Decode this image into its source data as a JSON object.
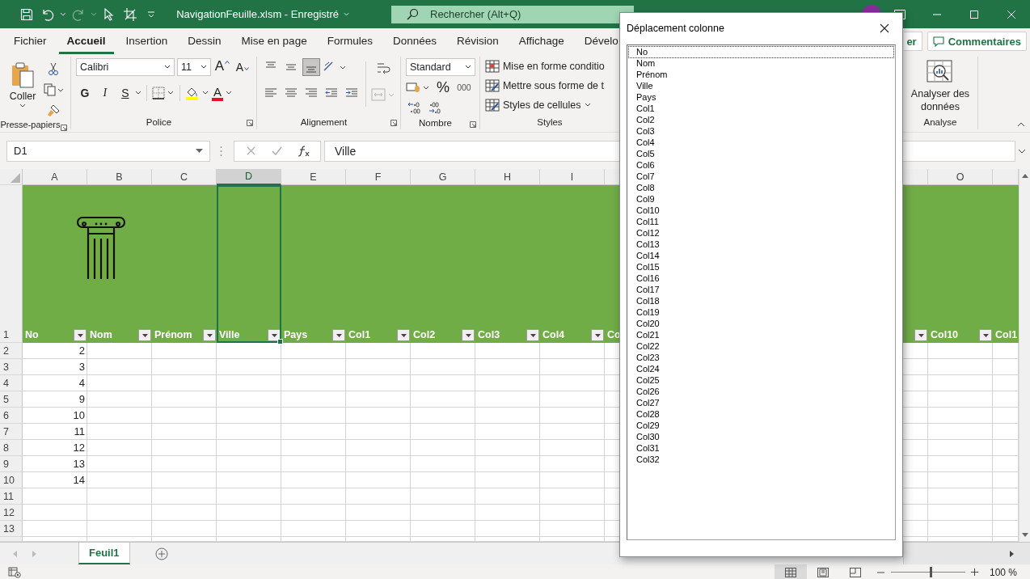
{
  "title_bar": {
    "title": "NavigationFeuille.xlsm  -  Enregistré",
    "search": {
      "placeholder": "Rechercher (Alt+Q)"
    },
    "redo_disabled": true
  },
  "ribbon_tabs": [
    {
      "label": "Fichier",
      "selected": false
    },
    {
      "label": "Accueil",
      "selected": true
    },
    {
      "label": "Insertion",
      "selected": false
    },
    {
      "label": "Dessin",
      "selected": false
    },
    {
      "label": "Mise en page",
      "selected": false
    },
    {
      "label": "Formules",
      "selected": false
    },
    {
      "label": "Données",
      "selected": false
    },
    {
      "label": "Révision",
      "selected": false
    },
    {
      "label": "Affichage",
      "selected": false
    },
    {
      "label": "Dévelo",
      "selected": false
    }
  ],
  "share_button": "er",
  "comments_button": "Commentaires",
  "ribbon": {
    "clipboard": {
      "paste": "Coller",
      "group": "Presse-papiers"
    },
    "font": {
      "family": "Calibri",
      "size": "11",
      "grow": "A",
      "shrink": "A",
      "bold": "G",
      "italic": "I",
      "underline": "S",
      "color_letter": "A",
      "group": "Police"
    },
    "alignment": {
      "vertical_buttons": [
        {
          "selected": false
        },
        {
          "selected": false
        },
        {
          "selected": true
        }
      ],
      "merge_disabled": true,
      "group": "Alignement"
    },
    "number": {
      "format": "Standard",
      "percent": "%",
      "thousands": "000",
      "group": "Nombre"
    },
    "styles": {
      "items": [
        "Mise en forme conditio",
        "Mettre sous forme de t",
        "Styles de cellules"
      ],
      "group": "Styles"
    },
    "analysis": {
      "button": "Analyser des données",
      "group": "Analyse"
    }
  },
  "formula_bar": {
    "name_box": "D1",
    "formula": "Ville"
  },
  "sheet": {
    "columns_left": [
      {
        "letter": "A",
        "header": "No",
        "filter": true,
        "selected": false
      },
      {
        "letter": "B",
        "header": "Nom",
        "filter": true,
        "selected": false
      },
      {
        "letter": "C",
        "header": "Prénom",
        "filter": true,
        "selected": false
      },
      {
        "letter": "D",
        "header": "Ville",
        "filter": true,
        "selected": true
      },
      {
        "letter": "E",
        "header": "Pays",
        "filter": true,
        "selected": false
      },
      {
        "letter": "F",
        "header": "Col1",
        "filter": true,
        "selected": false
      },
      {
        "letter": "G",
        "header": "Col2",
        "filter": true,
        "selected": false
      },
      {
        "letter": "H",
        "header": "Col3",
        "filter": true,
        "selected": false
      },
      {
        "letter": "I",
        "header": "Col4",
        "filter": true,
        "selected": false
      },
      {
        "header": "Co",
        "filter": false,
        "selected": false
      }
    ],
    "columns_right": [
      {
        "filter": true,
        "selected": false
      },
      {
        "letter": "O",
        "header": "Col10",
        "filter": true,
        "selected": false
      },
      {
        "header": "Col1",
        "filter": false,
        "selected": false
      }
    ],
    "header_row_number": "1",
    "rows": [
      {
        "number": "2",
        "value_a": "2"
      },
      {
        "number": "3",
        "value_a": "3"
      },
      {
        "number": "4",
        "value_a": "4"
      },
      {
        "number": "5",
        "value_a": "9"
      },
      {
        "number": "6",
        "value_a": "10"
      },
      {
        "number": "7",
        "value_a": "11"
      },
      {
        "number": "8",
        "value_a": "12"
      },
      {
        "number": "9",
        "value_a": "13"
      },
      {
        "number": "10",
        "value_a": "14"
      },
      {
        "number": "11"
      },
      {
        "number": "12"
      },
      {
        "number": "13"
      }
    ],
    "sheet_tabs": [
      {
        "label": "Feuil1",
        "selected": true
      }
    ]
  },
  "dialog": {
    "title": "Déplacement colonne",
    "items": [
      {
        "label": "No",
        "focused": true
      },
      {
        "label": "Nom",
        "focused": false
      },
      {
        "label": "Prénom",
        "focused": false
      },
      {
        "label": "Ville",
        "focused": false
      },
      {
        "label": "Pays",
        "focused": false
      },
      {
        "label": "Col1",
        "focused": false
      },
      {
        "label": "Col2",
        "focused": false
      },
      {
        "label": "Col3",
        "focused": false
      },
      {
        "label": "Col4",
        "focused": false
      },
      {
        "label": "Col5",
        "focused": false
      },
      {
        "label": "Col6",
        "focused": false
      },
      {
        "label": "Col7",
        "focused": false
      },
      {
        "label": "Col8",
        "focused": false
      },
      {
        "label": "Col9",
        "focused": false
      },
      {
        "label": "Col10",
        "focused": false
      },
      {
        "label": "Col11",
        "focused": false
      },
      {
        "label": "Col12",
        "focused": false
      },
      {
        "label": "Col13",
        "focused": false
      },
      {
        "label": "Col14",
        "focused": false
      },
      {
        "label": "Col15",
        "focused": false
      },
      {
        "label": "Col16",
        "focused": false
      },
      {
        "label": "Col17",
        "focused": false
      },
      {
        "label": "Col18",
        "focused": false
      },
      {
        "label": "Col19",
        "focused": false
      },
      {
        "label": "Col20",
        "focused": false
      },
      {
        "label": "Col21",
        "focused": false
      },
      {
        "label": "Col22",
        "focused": false
      },
      {
        "label": "Col23",
        "focused": false
      },
      {
        "label": "Col24",
        "focused": false
      },
      {
        "label": "Col25",
        "focused": false
      },
      {
        "label": "Col26",
        "focused": false
      },
      {
        "label": "Col27",
        "focused": false
      },
      {
        "label": "Col28",
        "focused": false
      },
      {
        "label": "Col29",
        "focused": false
      },
      {
        "label": "Col30",
        "focused": false
      },
      {
        "label": "Col31",
        "focused": false
      },
      {
        "label": "Col32",
        "focused": false
      }
    ]
  },
  "status_bar": {
    "views": [
      {
        "selected": true
      },
      {
        "selected": false
      },
      {
        "selected": false
      }
    ],
    "zoom": {
      "level": 0.53,
      "reading": "100 %"
    }
  }
}
